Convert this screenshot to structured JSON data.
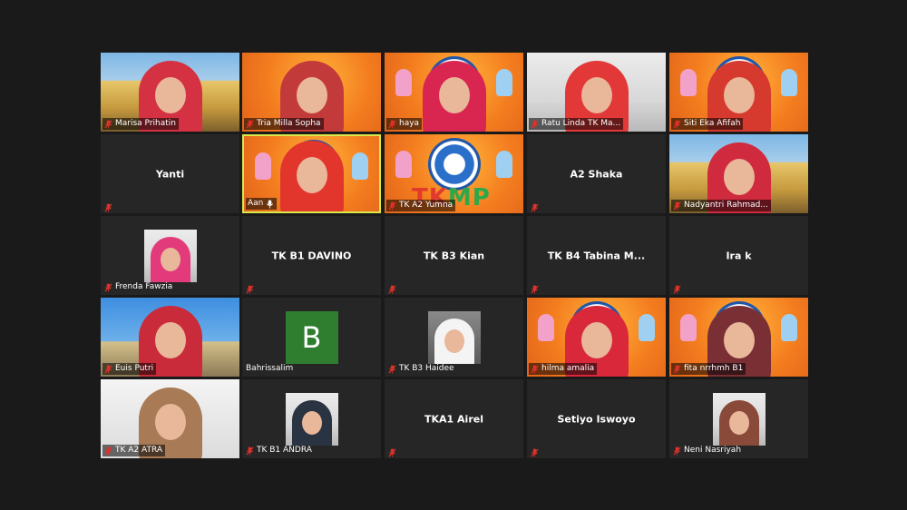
{
  "window": {
    "view": "Gallery View"
  },
  "colors": {
    "background": "#1a1a1a",
    "tile": "#262626",
    "active_border": "#d9e84a",
    "mute_red": "#e0312a",
    "letter_avatar": "#2f7d2f"
  },
  "participants": [
    {
      "name": "Marisa Prihatin",
      "video": true,
      "muted": true,
      "scene": "building",
      "hijab": "#d43242"
    },
    {
      "name": "Tria Milla Sopha",
      "video": true,
      "muted": true,
      "scene": "orange",
      "hijab": "#c33a3a"
    },
    {
      "name": "haya",
      "video": true,
      "muted": true,
      "scene": "orange-logo",
      "hijab": "#d92650"
    },
    {
      "name": "Ratu Linda TK Ma...",
      "video": true,
      "muted": true,
      "scene": "room",
      "hijab": "#e23838"
    },
    {
      "name": "Siti Eka Afifah",
      "video": true,
      "muted": true,
      "scene": "orange-logo",
      "hijab": "#d63a2e"
    },
    {
      "name": "Yanti",
      "video": false,
      "muted": true
    },
    {
      "name": "Aan",
      "video": true,
      "muted": true,
      "scene": "orange-logo",
      "hijab": "#e2352c",
      "active": true,
      "mic_icon": "microphone-icon"
    },
    {
      "name": "TK A2 Yumna",
      "video": true,
      "muted": true,
      "scene": "orange-logo-only"
    },
    {
      "name": "A2 Shaka",
      "video": false,
      "muted": true
    },
    {
      "name": "Nadyantri Rahmad...",
      "video": true,
      "muted": true,
      "scene": "building",
      "hijab": "#cf2a3e"
    },
    {
      "name": "Frenda Fawzia",
      "video": false,
      "muted": true,
      "avatar": "photo",
      "hijab": "#e23a7a"
    },
    {
      "name": "TK B1 DAVINO",
      "video": false,
      "muted": true
    },
    {
      "name": "TK B3 Kian",
      "video": false,
      "muted": true
    },
    {
      "name": "TK B4 Tabina M...",
      "video": false,
      "muted": true
    },
    {
      "name": "Ira k",
      "video": false,
      "muted": true
    },
    {
      "name": "Euis Putri",
      "video": true,
      "muted": true,
      "scene": "sky",
      "hijab": "#c92b3a"
    },
    {
      "name": "Bahrissalim",
      "video": false,
      "muted": false,
      "avatar": "letter",
      "letter": "B"
    },
    {
      "name": "TK B3 Haidee",
      "video": false,
      "muted": true,
      "avatar": "photo",
      "hijab": "#f4f4f4"
    },
    {
      "name": "hilma amalia",
      "video": true,
      "muted": true,
      "scene": "orange-logo",
      "hijab": "#d8283a"
    },
    {
      "name": "fita nrrhmh B1",
      "video": true,
      "muted": true,
      "scene": "orange-logo",
      "hijab": "#7a2f35"
    },
    {
      "name": "TK A2 ATRA",
      "video": true,
      "muted": true,
      "scene": "white",
      "hijab": "#a87a55"
    },
    {
      "name": "TK B1 ANDRA",
      "video": false,
      "muted": true,
      "avatar": "photo",
      "hijab": "#2a3342"
    },
    {
      "name": "TKA1 Airel",
      "video": false,
      "muted": true
    },
    {
      "name": "Setiyo Iswoyo",
      "video": false,
      "muted": true
    },
    {
      "name": "Neni Nasriyah",
      "video": false,
      "muted": true,
      "avatar": "photo",
      "hijab": "#8a4a3a"
    }
  ],
  "overlay": {
    "tkmp_tk": "TK",
    "tkmp_mp": "MP"
  }
}
